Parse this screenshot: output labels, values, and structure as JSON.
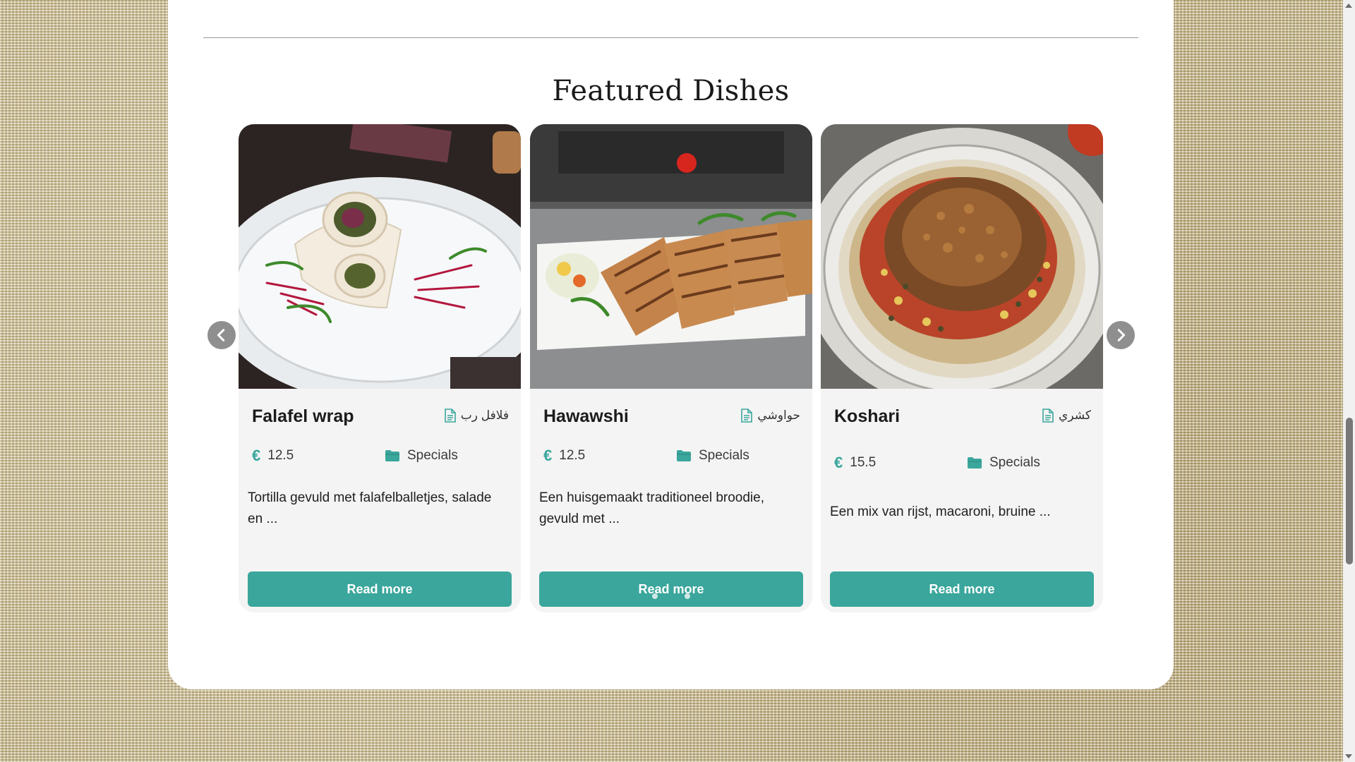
{
  "section": {
    "title": "Featured Dishes"
  },
  "carousel": {
    "prev_icon": "chevron-left-icon",
    "next_icon": "chevron-right-icon",
    "active_dot": 1,
    "dot_count": 3
  },
  "dishes": [
    {
      "name": "Falafel wrap",
      "arabic_name": "فلافل رب",
      "price": "12.5",
      "category": "Specials",
      "description": "Tortilla gevuld met falafelballetjes, salade en ...",
      "button_label": "Read more"
    },
    {
      "name": "Hawawshi",
      "arabic_name": "حواوشي",
      "price": "12.5",
      "category": "Specials",
      "description": "Een huisgemaakt traditioneel broodie, gevuld met ...",
      "button_label": "Read more"
    },
    {
      "name": "Koshari",
      "arabic_name": "كشري",
      "price": "15.5",
      "category": "Specials",
      "description": "Een mix van rijst, macaroni, bruine ...",
      "button_label": "Read more"
    }
  ],
  "icons": {
    "currency": "€",
    "doc": "document-icon",
    "folder": "folder-icon"
  },
  "colors": {
    "accent": "#3aa69c",
    "card_bg": "#f4f4f4",
    "arrow_bg": "#8f8f8f"
  }
}
